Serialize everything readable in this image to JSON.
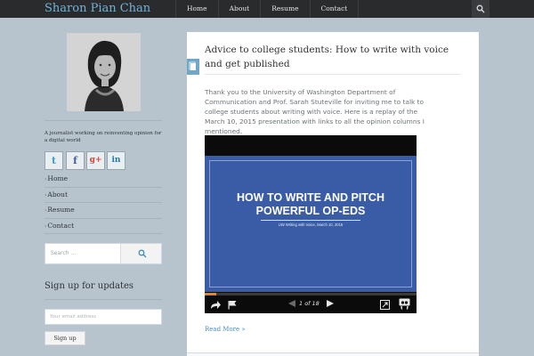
{
  "site": {
    "title": "Sharon Pian Chan"
  },
  "nav": {
    "items": [
      "Home",
      "About",
      "Resume",
      "Contact"
    ]
  },
  "sidebar": {
    "tagline": "A journalist working on reinventing opinion for a digital world",
    "social": [
      {
        "name": "twitter",
        "glyph": "t",
        "color": "#3d9ed9"
      },
      {
        "name": "facebook",
        "glyph": "f",
        "color": "#3b5c9a"
      },
      {
        "name": "google-plus",
        "glyph": "g+",
        "color": "#d2493a"
      },
      {
        "name": "linkedin",
        "glyph": "in",
        "color": "#1f78b4"
      }
    ],
    "menu": [
      "Home",
      "About",
      "Resume",
      "Contact"
    ],
    "search_placeholder": "Search ...",
    "signup_title": "Sign up for updates",
    "email_placeholder": "Your email address",
    "signup_button": "Sign up"
  },
  "article": {
    "title": "Advice to college students: How to write with voice and get published",
    "body": "Thank you to the University of Washington Department of Communication and Prof. Sarah Stuteville for inviting me to talk to college students about writing with voice. Here is a replay of the March 10, 2015 presentation with links to all the opinion columns I mentioned.",
    "read_more": "Read More »"
  },
  "embed": {
    "slide_title": "HOW TO WRITE AND PITCH POWERFUL OP-EDS",
    "slide_subtitle": "UW Writing with Voice, March 10, 2015",
    "page_count": "1 of 18",
    "progress": 0.055
  },
  "colors": {
    "accent": "#6fb3dc",
    "topbar": "#2a2b2d",
    "background": "#b7c4cd",
    "slide": "#3a5ca6",
    "progress": "#e2862a"
  }
}
